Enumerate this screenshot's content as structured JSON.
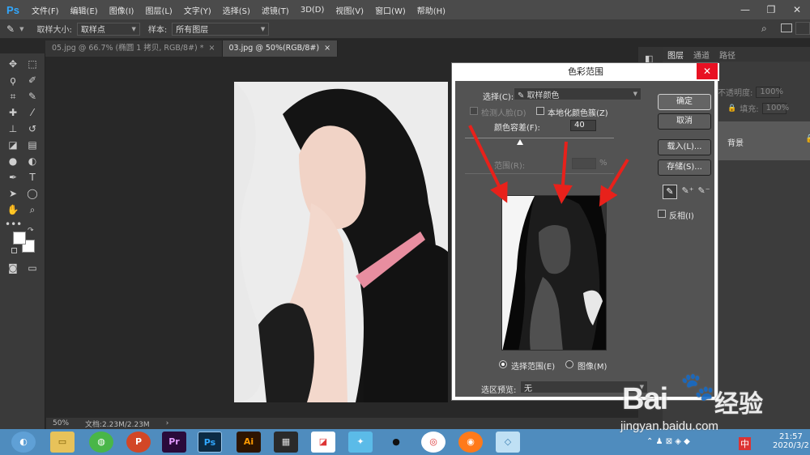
{
  "app": {
    "logo": "Ps"
  },
  "menu": [
    "文件(F)",
    "编辑(E)",
    "图像(I)",
    "图层(L)",
    "文字(Y)",
    "选择(S)",
    "滤镜(T)",
    "3D(D)",
    "视图(V)",
    "窗口(W)",
    "帮助(H)"
  ],
  "window_controls": {
    "minimize": "—",
    "restore": "❐",
    "close": "✕"
  },
  "options": {
    "sample_size_label": "取样大小:",
    "sample_size_value": "取样点",
    "sample_label": "样本:",
    "sample_value": "所有图层"
  },
  "tabs": [
    {
      "label": "05.jpg @ 66.7% (椭圆 1 拷贝, RGB/8#) *",
      "close": "×"
    },
    {
      "label": "03.jpg @ 50%(RGB/8#)",
      "close": "×"
    }
  ],
  "status": {
    "zoom": "50%",
    "doc": "文档:2.23M/2.23M",
    "arrow": "›"
  },
  "panel": {
    "tabs": [
      "图层",
      "通道",
      "路径"
    ],
    "opacity_label": "不透明度:",
    "opacity_value": "100%",
    "fill_label": "填充:",
    "fill_value": "100%",
    "layer_name": "背景"
  },
  "dialog": {
    "title": "色彩范围",
    "close": "✕",
    "select_label": "选择(C):",
    "select_value": "取样颜色",
    "detect_faces": "检测人脸(D)",
    "localized": "本地化颜色簇(Z)",
    "fuzziness_label": "颜色容差(F):",
    "fuzziness_value": "40",
    "range_label": "范围(R):",
    "range_unit": "%",
    "ok": "确定",
    "cancel": "取消",
    "load": "载入(L)...",
    "save": "存储(S)...",
    "invert": "反相(I)",
    "radio_selection": "选择范围(E)",
    "radio_image": "图像(M)",
    "preview_label": "选区预览:",
    "preview_value": "无"
  },
  "taskbar": {
    "clock_time": "21:57",
    "clock_date": "2020/3/2",
    "ime": "中"
  },
  "watermark": {
    "brand": "Bai",
    "brand2": "经验",
    "url": "jingyan.baidu.com"
  },
  "colors": {
    "accent": "#31a8ff",
    "close_red": "#e81123",
    "arrow_red": "#e8211b",
    "taskbar": "#4f8cbe"
  }
}
